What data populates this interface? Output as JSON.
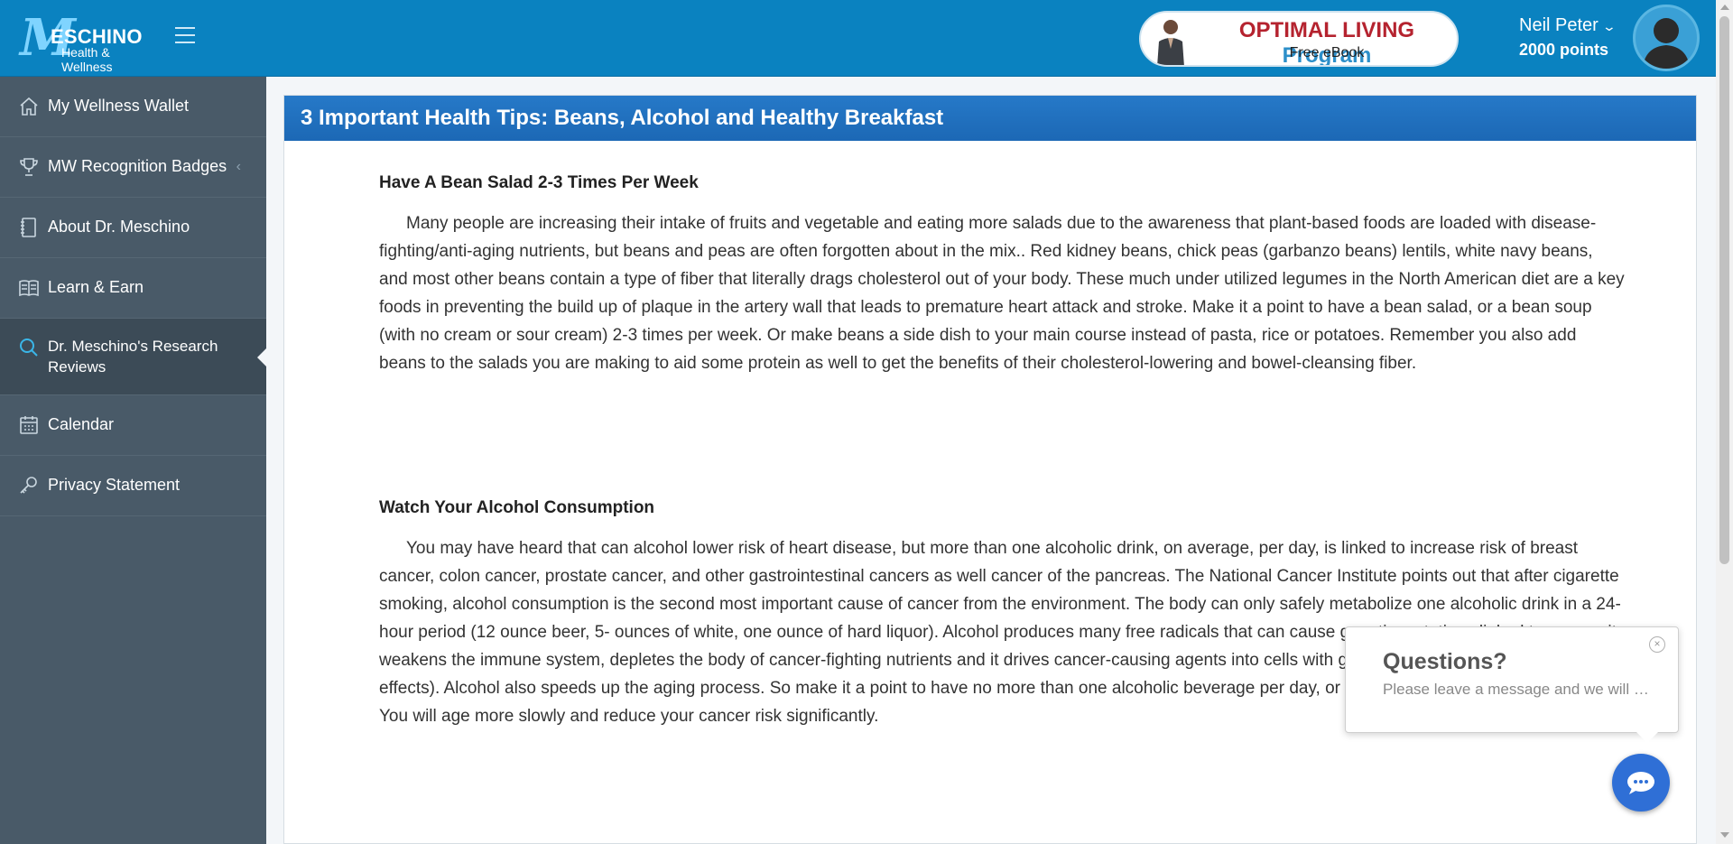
{
  "header": {
    "logo": {
      "letter": "M",
      "brand": "ESCHINO",
      "tagline": "Health & Wellness"
    },
    "promo": {
      "title_part1": "OPTIMAL LIVING",
      "title_part2": "Program",
      "subtitle": "Free eBook"
    },
    "user": {
      "name": "Neil Peter",
      "points": "2000 points"
    }
  },
  "sidebar": {
    "items": [
      {
        "label": "My Wellness Wallet",
        "icon": "home-icon"
      },
      {
        "label": "MW Recognition Badges",
        "icon": "trophy-icon",
        "caret": "‹"
      },
      {
        "label": "About Dr. Meschino",
        "icon": "notebook-icon"
      },
      {
        "label": "Learn & Earn",
        "icon": "book-icon"
      },
      {
        "label": "Dr. Meschino's Research Reviews",
        "icon": "search-icon",
        "active": true
      },
      {
        "label": "Calendar",
        "icon": "calendar-icon"
      },
      {
        "label": "Privacy Statement",
        "icon": "key-icon"
      }
    ]
  },
  "content": {
    "title": "3 Important Health Tips: Beans, Alcohol and Healthy Breakfast",
    "sections": [
      {
        "heading": "Have A Bean Salad 2-3 Times Per Week",
        "body": "Many people are increasing their intake of fruits and vegetable and eating more salads due to the awareness that plant-based foods are loaded with disease-fighting/anti-aging nutrients, but beans and peas are often forgotten about in the mix.. Red kidney beans, chick peas (garbanzo beans) lentils, white navy beans, and most other beans contain a type of fiber that literally drags cholesterol out of your body. These much under utilized legumes in the North American diet are a key foods in preventing the build up of plaque in the artery wall that leads to premature heart attack and stroke. Make it a point to have a bean salad, or a bean soup (with no cream or sour cream) 2-3 times per week. Or make beans a side dish to your main course instead of pasta, rice or potatoes. Remember you also add beans to the salads you are making to aid some protein as well to get the benefits of their cholesterol-lowering and bowel-cleansing fiber."
      },
      {
        "heading": "Watch Your Alcohol Consumption",
        "body": "You may have heard that can alcohol lower risk of heart disease, but more than one alcoholic drink, on average, per day, is linked to increase risk of breast cancer, colon cancer, prostate cancer, and other gastrointestinal cancers as well cancer of the pancreas. The National Cancer Institute points out that after cigarette smoking, alcohol consumption is the second most important cause of cancer from the environment. The body can only safely metabolize one alcoholic drink in a 24-hour period (12 ounce beer, 5- ounces of white, one ounce of hard liquor). Alcohol produces many free radicals that can cause genetic mutations linked to cancer, it weakens the immune system, depletes the body of cancer-fighting nutrients and it drives cancer-causing agents into cells with greater efficiency (co-carcinogen effects). Alcohol also speeds up the aging process. So make it a point to have no more than one alcoholic beverage per day, or refrain from drinking it altogether. You will age more slowly and reduce your cancer risk significantly."
      }
    ]
  },
  "chat": {
    "title": "Questions?",
    "subtitle": "Please leave a message and we will …",
    "close": "×"
  },
  "colors": {
    "topbar": "#0a82c0",
    "sidebar": "#495a68",
    "panel_header": "#1c6fc0",
    "chat_button": "#2f6fd6"
  }
}
